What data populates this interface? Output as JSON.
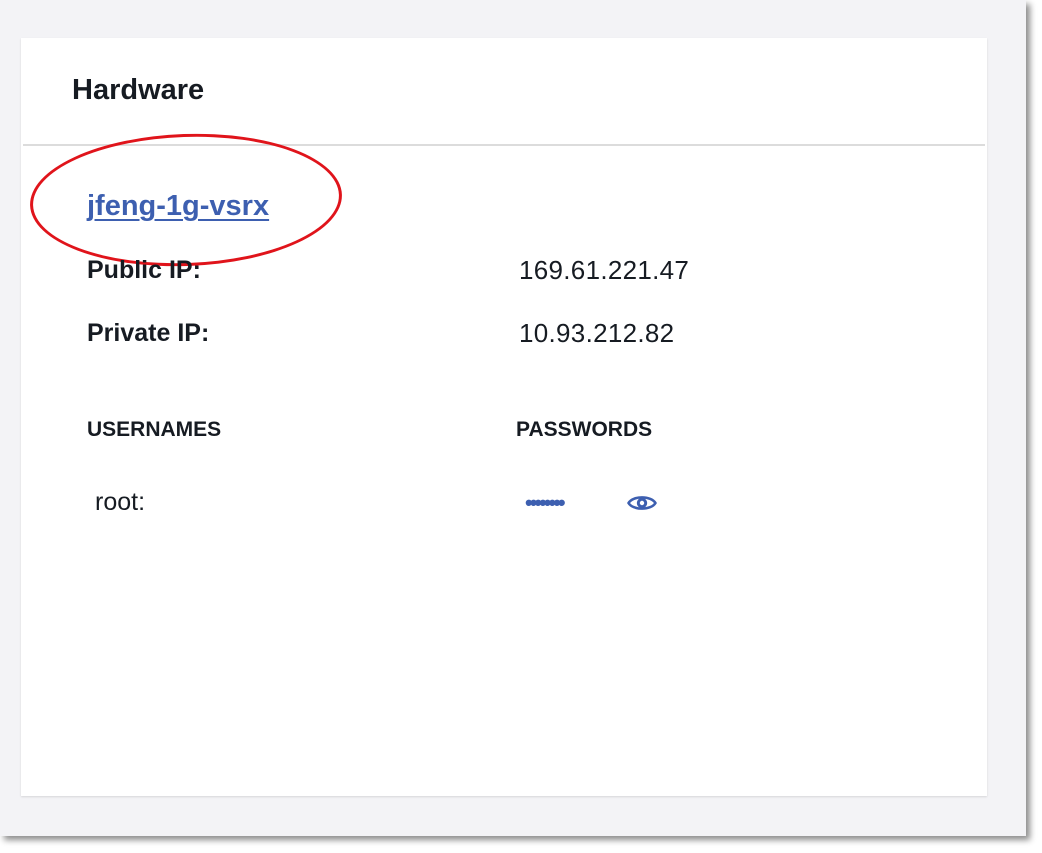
{
  "card": {
    "title": "Hardware"
  },
  "hardware": {
    "host_name": "jfeng-1g-vsrx",
    "public_ip_label": "Public IP:",
    "public_ip": "169.61.221.47",
    "private_ip_label": "Private IP:",
    "private_ip": "10.93.212.82"
  },
  "credentials": {
    "usernames_header": "USERNAMES",
    "passwords_header": "PASSWORDS",
    "rows": [
      {
        "username": "root:",
        "password_masked": "••••••••"
      }
    ],
    "reveal_icon": "eye-icon"
  },
  "colors": {
    "link": "#3d5fb0",
    "annotation": "#e0141b",
    "text": "#161b22",
    "divider": "#dcdcdc"
  }
}
